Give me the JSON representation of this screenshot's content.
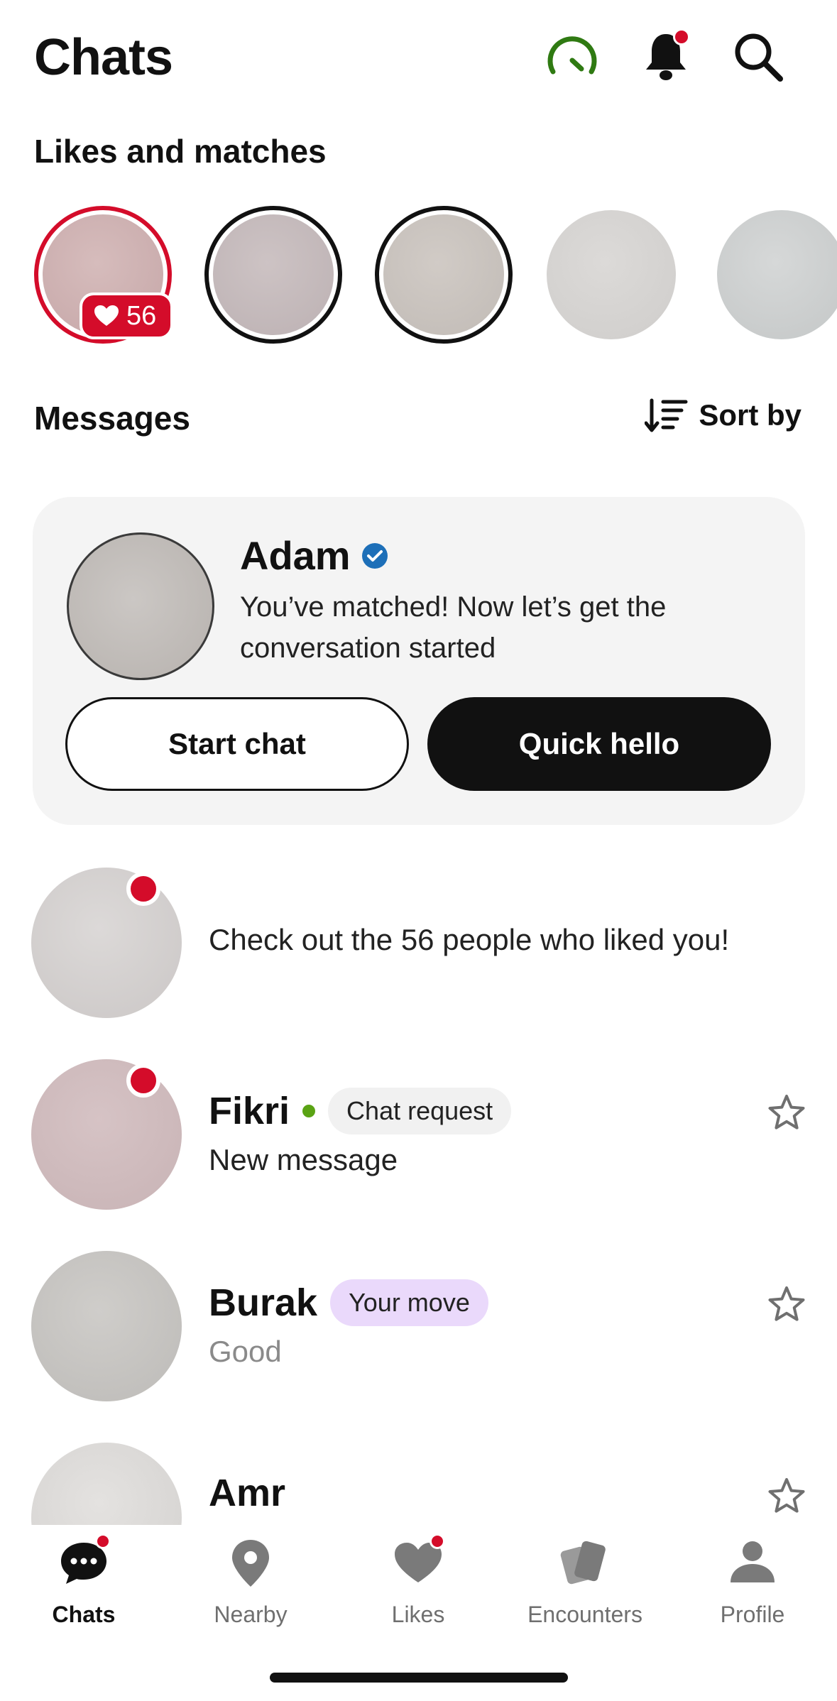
{
  "header": {
    "title": "Chats",
    "accent_green": "#2f7a12",
    "icons": [
      "speedometer-icon",
      "bell-icon",
      "search-icon"
    ]
  },
  "likes_section": {
    "title": "Likes and matches",
    "likes_count": "56"
  },
  "messages_section": {
    "title": "Messages",
    "sort_label": "Sort by"
  },
  "match_card": {
    "name": "Adam",
    "text": "You’ve matched! Now let’s get the conversation started",
    "start_chat": "Start chat",
    "quick_hello": "Quick hello"
  },
  "conversations": [
    {
      "name": "",
      "message": "Check out the 56 people who liked you!",
      "badge": "",
      "unread": true
    },
    {
      "name": "Fikri",
      "message": "New message",
      "badge": "Chat request",
      "online": true,
      "unread": true
    },
    {
      "name": "Burak",
      "message": "Good",
      "badge": "Your move",
      "unread": false
    },
    {
      "name": "Amr",
      "message": "",
      "badge": "",
      "unread": false
    }
  ],
  "tabs": [
    {
      "label": "Chats",
      "icon": "chat-bubbles-icon",
      "active": true
    },
    {
      "label": "Nearby",
      "icon": "location-pin-icon",
      "active": false
    },
    {
      "label": "Likes",
      "icon": "heart-icon",
      "active": false
    },
    {
      "label": "Encounters",
      "icon": "cards-icon",
      "active": false
    },
    {
      "label": "Profile",
      "icon": "person-icon",
      "active": false
    }
  ],
  "colors": {
    "brand_red": "#d40c2a",
    "online_green": "#5aa314",
    "chip_purple": "#ead9fb",
    "verified_blue": "#1d6fb8"
  }
}
